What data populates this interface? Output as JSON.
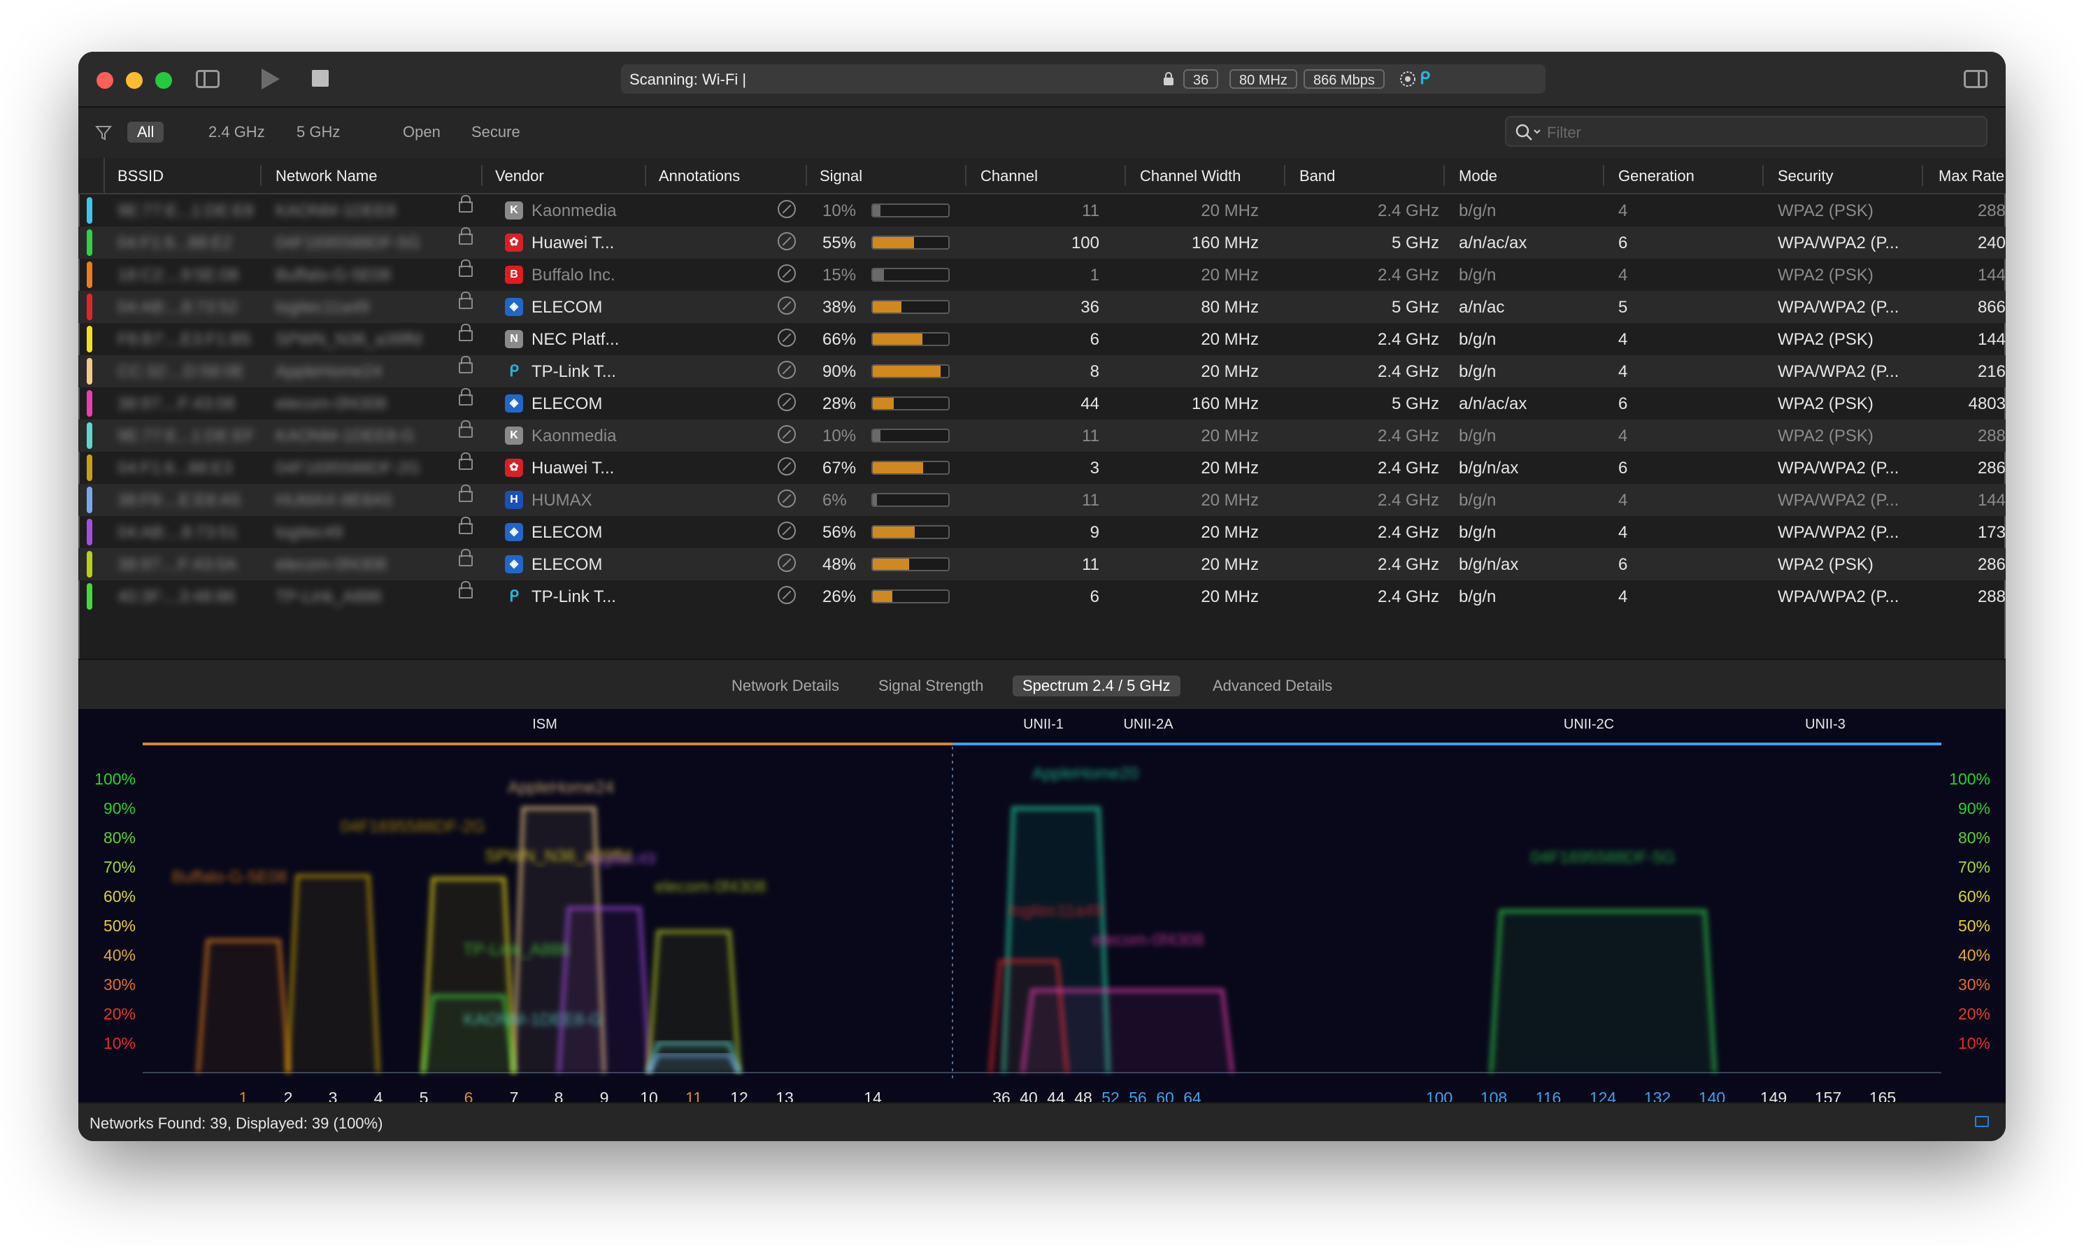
{
  "window": {
    "scan_text": "Scanning: Wi-Fi  |",
    "pills": [
      "36",
      "80 MHz",
      "866 Mbps"
    ]
  },
  "filters": {
    "tabs": [
      "All",
      "2.4 GHz",
      "5 GHz",
      "Open",
      "Secure"
    ],
    "active": "All",
    "search_placeholder": "Filter"
  },
  "columns": [
    "BSSID",
    "Network Name",
    "Vendor",
    "Annotations",
    "Signal",
    "Channel",
    "Channel Width",
    "Band",
    "Mode",
    "Generation",
    "Security",
    "Max Rate"
  ],
  "networks": [
    {
      "color": "#3ec6e8",
      "bssid": "9E:77:E...1:DE:E8",
      "name": "KAONM-1DEE8",
      "vendor": "Kaonmedia",
      "vicon": "K",
      "vbg": "#8a8a8a",
      "signal": "10%",
      "signal_value": 0.1,
      "channel": "11",
      "width": "20 MHz",
      "band": "2.4 GHz",
      "mode": "b/g/n",
      "gen": "4",
      "security": "WPA2 (PSK)",
      "rate": "288",
      "dim": true
    },
    {
      "color": "#2fd14a",
      "bssid": "04:F1:6...88:E2",
      "name": "04F1695588DF-5G",
      "vendor": "Huawei T...",
      "vicon": "✿",
      "vbg": "#d8202a",
      "signal": "55%",
      "signal_value": 0.55,
      "channel": "100",
      "width": "160 MHz",
      "band": "5 GHz",
      "mode": "a/n/ac/ax",
      "gen": "6",
      "security": "WPA/WPA2 (P...",
      "rate": "240",
      "dim": false
    },
    {
      "color": "#ea7d1e",
      "bssid": "18:C2:...9:5E:08",
      "name": "Buffalo-G-5E08",
      "vendor": "Buffalo Inc.",
      "vicon": "B",
      "vbg": "#e11b22",
      "signal": "15%",
      "signal_value": 0.15,
      "channel": "1",
      "width": "20 MHz",
      "band": "2.4 GHz",
      "mode": "b/g/n",
      "gen": "4",
      "security": "WPA2 (PSK)",
      "rate": "144",
      "dim": true
    },
    {
      "color": "#e0262b",
      "bssid": "04:AB:...8:73:52",
      "name": "logitec11a49",
      "vendor": "ELECOM",
      "vicon": "◈",
      "vbg": "#2266c8",
      "signal": "38%",
      "signal_value": 0.38,
      "channel": "36",
      "width": "80 MHz",
      "band": "5 GHz",
      "mode": "a/n/ac",
      "gen": "5",
      "security": "WPA/WPA2 (P...",
      "rate": "866",
      "dim": false
    },
    {
      "color": "#f3e21d",
      "bssid": "F8:B7:...E3:F1:B5",
      "name": "SPWN_N36_a39ffd",
      "vendor": "NEC Platf...",
      "vicon": "N",
      "vbg": "#8a8a8a",
      "signal": "66%",
      "signal_value": 0.66,
      "channel": "6",
      "width": "20 MHz",
      "band": "2.4 GHz",
      "mode": "b/g/n",
      "gen": "4",
      "security": "WPA2 (PSK)",
      "rate": "144",
      "dim": false
    },
    {
      "color": "#f3c98a",
      "bssid": "CC:32:...D:58:0E",
      "name": "AppleHome24",
      "vendor": "TP-Link T...",
      "vicon": "ᑭ",
      "vbg": "transparent",
      "signal": "90%",
      "signal_value": 0.9,
      "channel": "8",
      "width": "20 MHz",
      "band": "2.4 GHz",
      "mode": "b/g/n",
      "gen": "4",
      "security": "WPA/WPA2 (P...",
      "rate": "216",
      "dim": false
    },
    {
      "color": "#ea3fb0",
      "bssid": "38:97:...F:43:08",
      "name": "elecom-0f4308",
      "vendor": "ELECOM",
      "vicon": "◈",
      "vbg": "#2266c8",
      "signal": "28%",
      "signal_value": 0.28,
      "channel": "44",
      "width": "160 MHz",
      "band": "5 GHz",
      "mode": "a/n/ac/ax",
      "gen": "6",
      "security": "WPA2 (PSK)",
      "rate": "4803",
      "dim": false
    },
    {
      "color": "#5fd6cf",
      "bssid": "9E:77:E...1:DE:EF",
      "name": "KAONM-1DEE8-G",
      "vendor": "Kaonmedia",
      "vicon": "K",
      "vbg": "#8a8a8a",
      "signal": "10%",
      "signal_value": 0.1,
      "channel": "11",
      "width": "20 MHz",
      "band": "2.4 GHz",
      "mode": "b/g/n",
      "gen": "4",
      "security": "WPA2 (PSK)",
      "rate": "288",
      "dim": true
    },
    {
      "color": "#c9a014",
      "bssid": "04:F1:6...88:E3",
      "name": "04F1695588DF-2G",
      "vendor": "Huawei T...",
      "vicon": "✿",
      "vbg": "#d8202a",
      "signal": "67%",
      "signal_value": 0.67,
      "channel": "3",
      "width": "20 MHz",
      "band": "2.4 GHz",
      "mode": "b/g/n/ax",
      "gen": "6",
      "security": "WPA/WPA2 (P...",
      "rate": "286",
      "dim": false
    },
    {
      "color": "#7aa8f0",
      "bssid": "38:F8:...E:E8:A5",
      "name": "HUMAX-8E8A5",
      "vendor": "HUMAX",
      "vicon": "H",
      "vbg": "#1d4fb8",
      "signal": "6%",
      "signal_value": 0.06,
      "channel": "11",
      "width": "20 MHz",
      "band": "2.4 GHz",
      "mode": "b/g/n",
      "gen": "4",
      "security": "WPA/WPA2 (P...",
      "rate": "144",
      "dim": true
    },
    {
      "color": "#a64ee0",
      "bssid": "04:AB:...8:73:51",
      "name": "logitec49",
      "vendor": "ELECOM",
      "vicon": "◈",
      "vbg": "#2266c8",
      "signal": "56%",
      "signal_value": 0.56,
      "channel": "9",
      "width": "20 MHz",
      "band": "2.4 GHz",
      "mode": "b/g/n",
      "gen": "4",
      "security": "WPA/WPA2 (P...",
      "rate": "173",
      "dim": false
    },
    {
      "color": "#b8cf1c",
      "bssid": "38:97:...F:43:0A",
      "name": "elecom-0f4308",
      "vendor": "ELECOM",
      "vicon": "◈",
      "vbg": "#2266c8",
      "signal": "48%",
      "signal_value": 0.48,
      "channel": "11",
      "width": "20 MHz",
      "band": "2.4 GHz",
      "mode": "b/g/n/ax",
      "gen": "6",
      "security": "WPA2 (PSK)",
      "rate": "286",
      "dim": false
    },
    {
      "color": "#46d83c",
      "bssid": "40:3F:...3:48:86",
      "name": "TP-Link_A886",
      "vendor": "TP-Link T...",
      "vicon": "ᑭ",
      "vbg": "transparent",
      "signal": "26%",
      "signal_value": 0.26,
      "channel": "6",
      "width": "20 MHz",
      "band": "2.4 GHz",
      "mode": "b/g/n",
      "gen": "4",
      "security": "WPA/WPA2 (P...",
      "rate": "288",
      "dim": false
    }
  ],
  "detail_tabs": [
    "Network Details",
    "Signal Strength",
    "Spectrum 2.4 / 5 GHz",
    "Advanced Details"
  ],
  "detail_active": "Spectrum 2.4 / 5 GHz",
  "spectrum": {
    "bands": [
      "ISM",
      "UNII-1",
      "UNII-2A",
      "UNII-2C",
      "UNII-3"
    ],
    "y_labels": [
      "100%",
      "90%",
      "80%",
      "70%",
      "60%",
      "50%",
      "40%",
      "30%",
      "20%",
      "10%"
    ],
    "channels_24": [
      "1",
      "2",
      "3",
      "4",
      "5",
      "6",
      "7",
      "8",
      "9",
      "10",
      "11",
      "12",
      "13",
      "14"
    ],
    "channels_5_low": [
      "36",
      "40",
      "44",
      "48",
      "52",
      "56",
      "60",
      "64"
    ],
    "channels_5_high": [
      "100",
      "108",
      "116",
      "124",
      "132",
      "140",
      "149",
      "157",
      "165"
    ],
    "network_labels": [
      "AppleHome24",
      "04F1695588DF-2G",
      "SPWN_N36_a39ffd",
      "Buffalo-G-5E08",
      "logitec49",
      "elecom-0f4308",
      "TP-Link_A886",
      "KAONM-1DEE8-G",
      "AppleHome20",
      "logitec11a49",
      "elecom-0f4308",
      "04F1695588DF-5G"
    ]
  },
  "status": "Networks Found: 39, Displayed: 39 (100%)"
}
